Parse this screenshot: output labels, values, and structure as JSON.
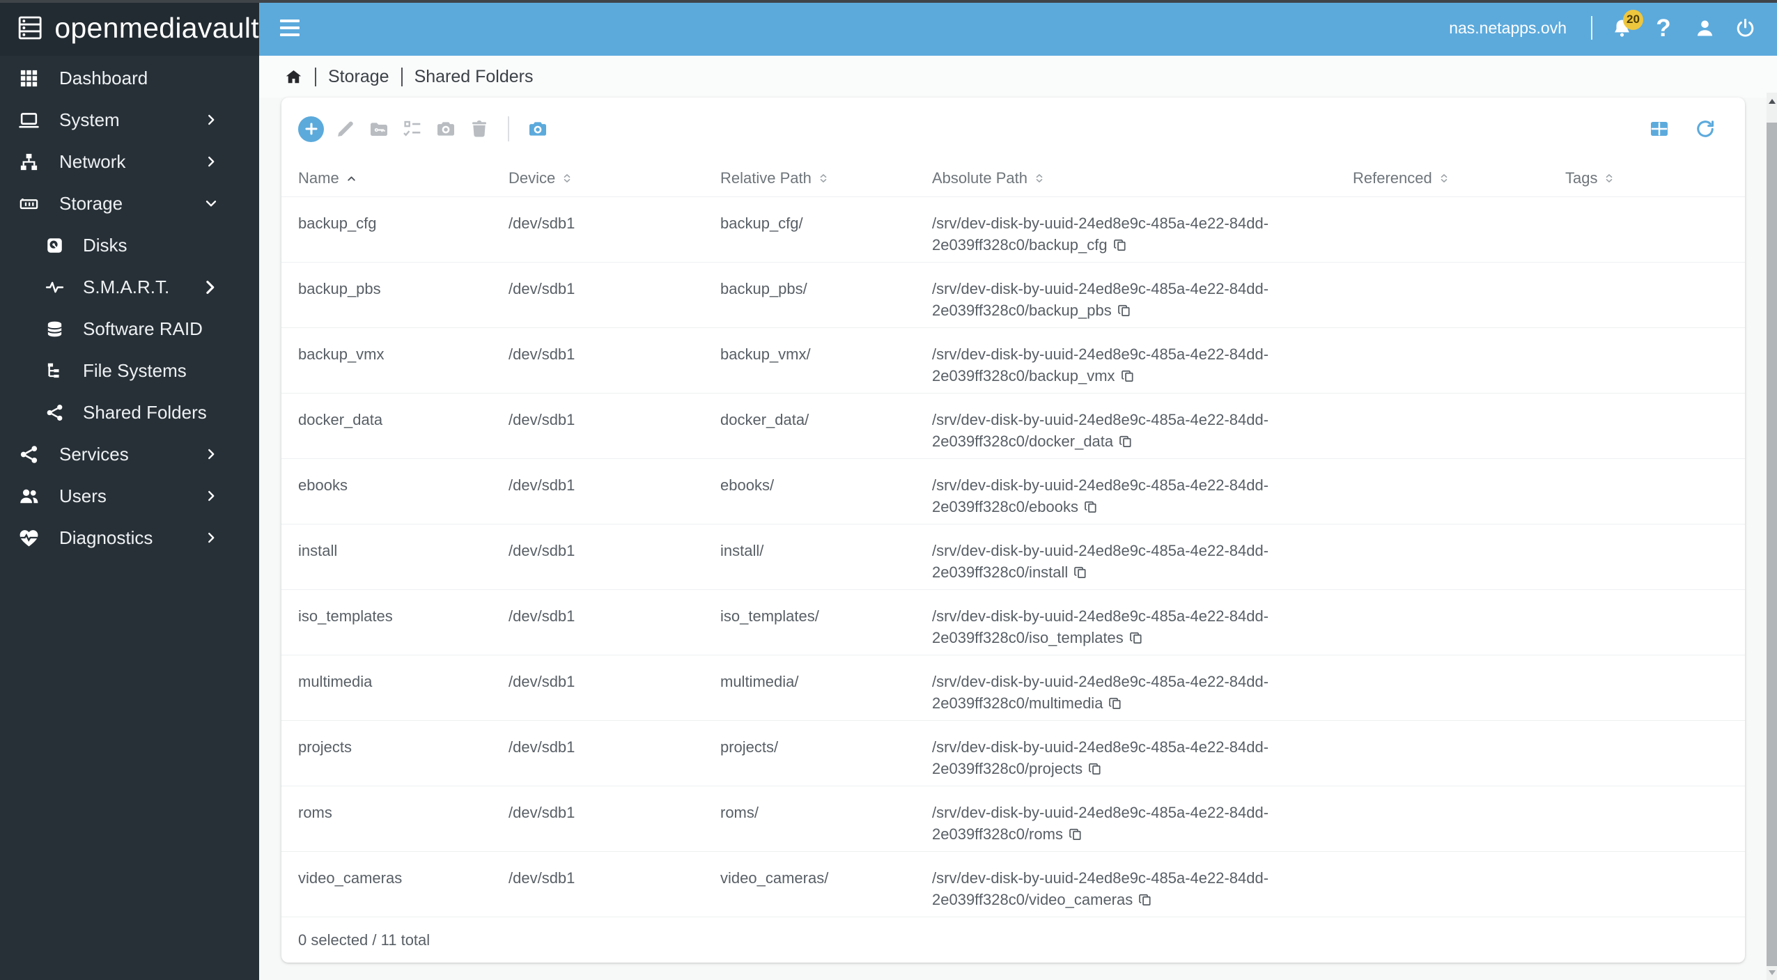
{
  "logo": {
    "text": "openmediavault"
  },
  "topbar": {
    "hostname": "nas.netapps.ovh",
    "notifications_badge": "20",
    "icons": [
      "bell",
      "help",
      "user",
      "power"
    ]
  },
  "breadcrumb": {
    "items": [
      "Storage",
      "Shared Folders"
    ]
  },
  "sidebar": {
    "items": [
      {
        "label": "Dashboard",
        "icon": "dashboard",
        "sub": false,
        "chevron": null
      },
      {
        "label": "System",
        "icon": "system",
        "sub": false,
        "chevron": "right"
      },
      {
        "label": "Network",
        "icon": "network",
        "sub": false,
        "chevron": "right"
      },
      {
        "label": "Storage",
        "icon": "storage",
        "sub": false,
        "chevron": "down"
      },
      {
        "label": "Disks",
        "icon": "disks",
        "sub": true,
        "chevron": null
      },
      {
        "label": "S.M.A.R.T.",
        "icon": "smart",
        "sub": true,
        "chevron": "right"
      },
      {
        "label": "Software RAID",
        "icon": "raid",
        "sub": true,
        "chevron": null
      },
      {
        "label": "File Systems",
        "icon": "filesystems",
        "sub": true,
        "chevron": null
      },
      {
        "label": "Shared Folders",
        "icon": "share",
        "sub": true,
        "chevron": null
      },
      {
        "label": "Services",
        "icon": "share",
        "sub": false,
        "chevron": "right"
      },
      {
        "label": "Users",
        "icon": "users",
        "sub": false,
        "chevron": "right"
      },
      {
        "label": "Diagnostics",
        "icon": "diagnostics",
        "sub": false,
        "chevron": "right"
      }
    ]
  },
  "toolbar": {
    "left": [
      {
        "name": "add",
        "icon": "plus",
        "state": "primary"
      },
      {
        "name": "edit",
        "icon": "pencil",
        "state": "disabled"
      },
      {
        "name": "privileges",
        "icon": "folderkey",
        "state": "disabled"
      },
      {
        "name": "access-control",
        "icon": "checklist",
        "state": "disabled"
      },
      {
        "name": "snapshot",
        "icon": "camera",
        "state": "disabled"
      },
      {
        "name": "delete",
        "icon": "trash",
        "state": "disabled"
      },
      {
        "divider": true
      },
      {
        "name": "snapshots",
        "icon": "camera",
        "state": "accent"
      }
    ],
    "right": [
      {
        "name": "columns",
        "icon": "gridtable"
      },
      {
        "name": "reload",
        "icon": "refresh"
      }
    ]
  },
  "table": {
    "columns": [
      {
        "label": "Name",
        "sort": "asc"
      },
      {
        "label": "Device",
        "sort": "both"
      },
      {
        "label": "Relative Path",
        "sort": "both"
      },
      {
        "label": "Absolute Path",
        "sort": "both"
      },
      {
        "label": "Referenced",
        "sort": "both"
      },
      {
        "label": "Tags",
        "sort": "both"
      }
    ],
    "rows": [
      {
        "name": "backup_cfg",
        "device": "/dev/sdb1",
        "relative": "backup_cfg/",
        "absolute": "/srv/dev-disk-by-uuid-24ed8e9c-485a-4e22-84dd-2e039ff328c0/backup_cfg",
        "referenced": "",
        "tags": ""
      },
      {
        "name": "backup_pbs",
        "device": "/dev/sdb1",
        "relative": "backup_pbs/",
        "absolute": "/srv/dev-disk-by-uuid-24ed8e9c-485a-4e22-84dd-2e039ff328c0/backup_pbs",
        "referenced": "",
        "tags": ""
      },
      {
        "name": "backup_vmx",
        "device": "/dev/sdb1",
        "relative": "backup_vmx/",
        "absolute": "/srv/dev-disk-by-uuid-24ed8e9c-485a-4e22-84dd-2e039ff328c0/backup_vmx",
        "referenced": "",
        "tags": ""
      },
      {
        "name": "docker_data",
        "device": "/dev/sdb1",
        "relative": "docker_data/",
        "absolute": "/srv/dev-disk-by-uuid-24ed8e9c-485a-4e22-84dd-2e039ff328c0/docker_data",
        "referenced": "",
        "tags": ""
      },
      {
        "name": "ebooks",
        "device": "/dev/sdb1",
        "relative": "ebooks/",
        "absolute": "/srv/dev-disk-by-uuid-24ed8e9c-485a-4e22-84dd-2e039ff328c0/ebooks",
        "referenced": "",
        "tags": ""
      },
      {
        "name": "install",
        "device": "/dev/sdb1",
        "relative": "install/",
        "absolute": "/srv/dev-disk-by-uuid-24ed8e9c-485a-4e22-84dd-2e039ff328c0/install",
        "referenced": "",
        "tags": ""
      },
      {
        "name": "iso_templates",
        "device": "/dev/sdb1",
        "relative": "iso_templates/",
        "absolute": "/srv/dev-disk-by-uuid-24ed8e9c-485a-4e22-84dd-2e039ff328c0/iso_templates",
        "referenced": "",
        "tags": ""
      },
      {
        "name": "multimedia",
        "device": "/dev/sdb1",
        "relative": "multimedia/",
        "absolute": "/srv/dev-disk-by-uuid-24ed8e9c-485a-4e22-84dd-2e039ff328c0/multimedia",
        "referenced": "",
        "tags": ""
      },
      {
        "name": "projects",
        "device": "/dev/sdb1",
        "relative": "projects/",
        "absolute": "/srv/dev-disk-by-uuid-24ed8e9c-485a-4e22-84dd-2e039ff328c0/projects",
        "referenced": "",
        "tags": ""
      },
      {
        "name": "roms",
        "device": "/dev/sdb1",
        "relative": "roms/",
        "absolute": "/srv/dev-disk-by-uuid-24ed8e9c-485a-4e22-84dd-2e039ff328c0/roms",
        "referenced": "",
        "tags": ""
      },
      {
        "name": "video_cameras",
        "device": "/dev/sdb1",
        "relative": "video_cameras/",
        "absolute": "/srv/dev-disk-by-uuid-24ed8e9c-485a-4e22-84dd-2e039ff328c0/video_cameras",
        "referenced": "",
        "tags": ""
      }
    ],
    "footer": "0 selected / 11 total"
  },
  "colors": {
    "accent": "#5caadc",
    "topbar": "#5caadc",
    "sidebar_bg": "#273037",
    "badge": "#eec63e"
  }
}
